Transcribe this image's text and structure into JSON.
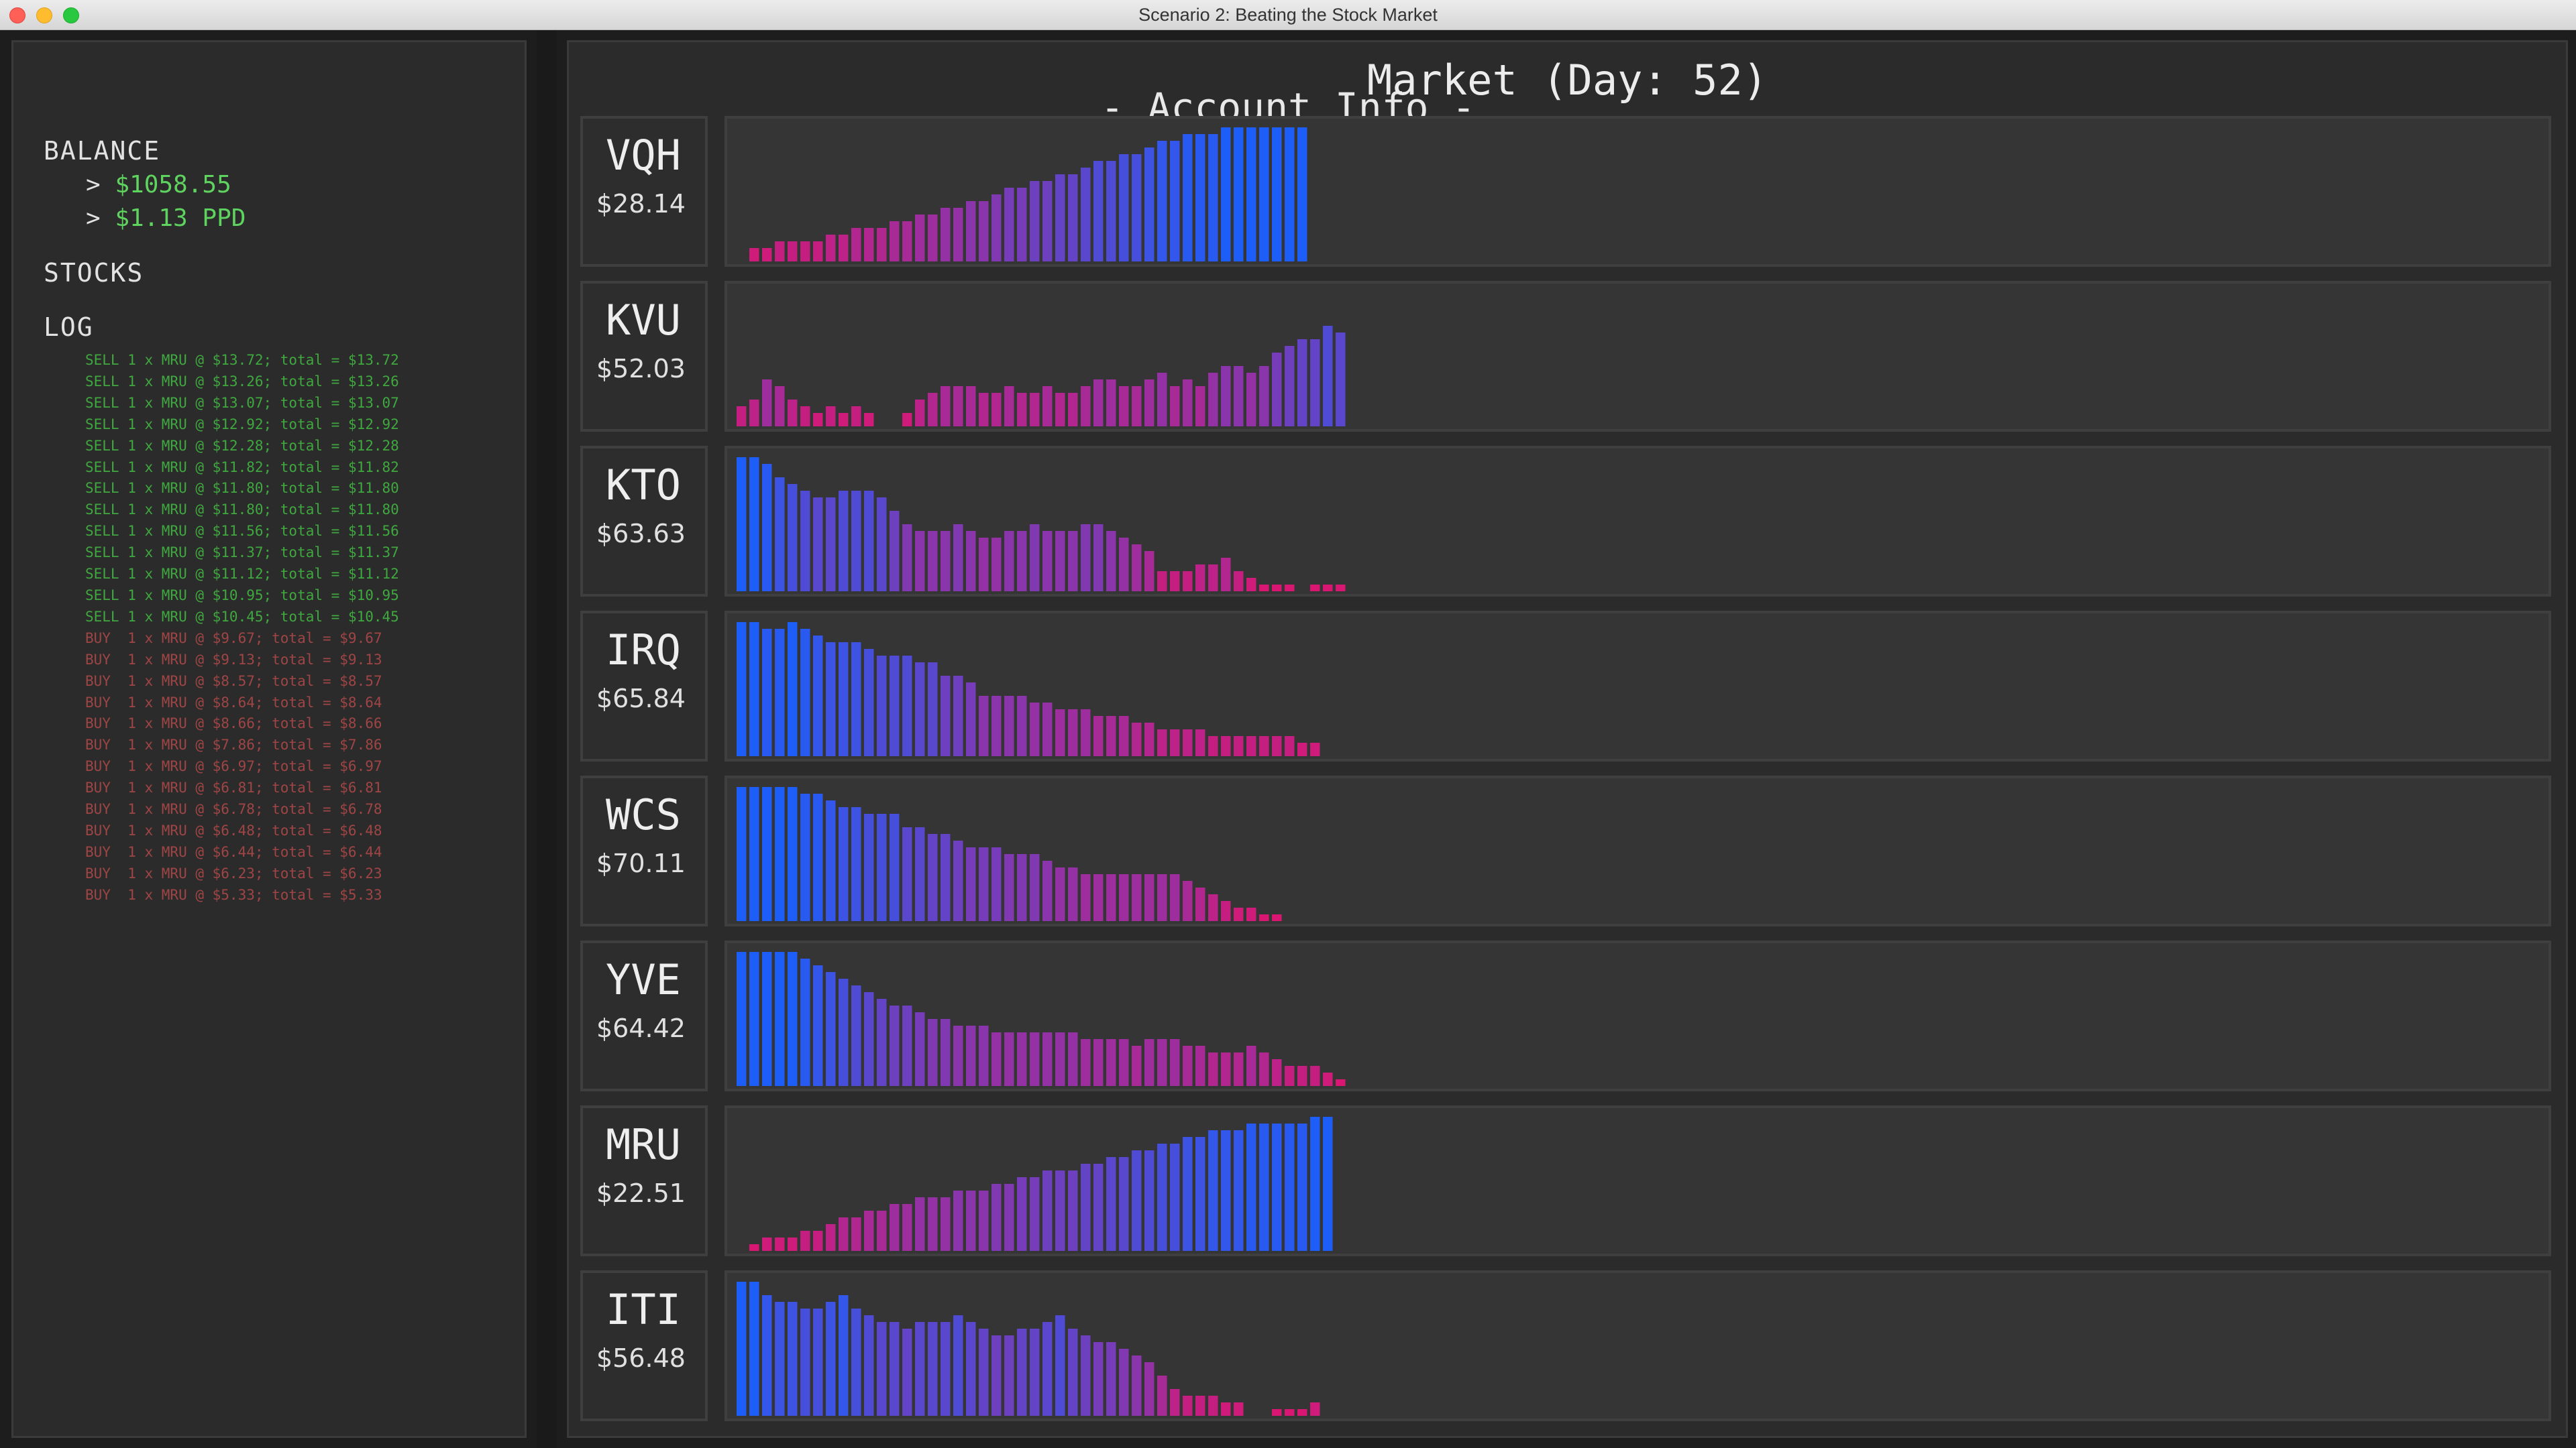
{
  "window": {
    "title": "Scenario 2: Beating the Stock Market"
  },
  "account": {
    "title": "- Account Info -",
    "balance_label": "BALANCE",
    "balance_value": "$1058.55",
    "ppd_value": "$1.13 PPD",
    "stocks_label": "STOCKS",
    "log_label": "LOG",
    "log": [
      {
        "type": "sell",
        "text": "SELL 1 x MRU @ $13.72; total = $13.72"
      },
      {
        "type": "sell",
        "text": "SELL 1 x MRU @ $13.26; total = $13.26"
      },
      {
        "type": "sell",
        "text": "SELL 1 x MRU @ $13.07; total = $13.07"
      },
      {
        "type": "sell",
        "text": "SELL 1 x MRU @ $12.92; total = $12.92"
      },
      {
        "type": "sell",
        "text": "SELL 1 x MRU @ $12.28; total = $12.28"
      },
      {
        "type": "sell",
        "text": "SELL 1 x MRU @ $11.82; total = $11.82"
      },
      {
        "type": "sell",
        "text": "SELL 1 x MRU @ $11.80; total = $11.80"
      },
      {
        "type": "sell",
        "text": "SELL 1 x MRU @ $11.80; total = $11.80"
      },
      {
        "type": "sell",
        "text": "SELL 1 x MRU @ $11.56; total = $11.56"
      },
      {
        "type": "sell",
        "text": "SELL 1 x MRU @ $11.37; total = $11.37"
      },
      {
        "type": "sell",
        "text": "SELL 1 x MRU @ $11.12; total = $11.12"
      },
      {
        "type": "sell",
        "text": "SELL 1 x MRU @ $10.95; total = $10.95"
      },
      {
        "type": "sell",
        "text": "SELL 1 x MRU @ $10.45; total = $10.45"
      },
      {
        "type": "buy",
        "text": "BUY  1 x MRU @ $9.67; total = $9.67"
      },
      {
        "type": "buy",
        "text": "BUY  1 x MRU @ $9.13; total = $9.13"
      },
      {
        "type": "buy",
        "text": "BUY  1 x MRU @ $8.57; total = $8.57"
      },
      {
        "type": "buy",
        "text": "BUY  1 x MRU @ $8.64; total = $8.64"
      },
      {
        "type": "buy",
        "text": "BUY  1 x MRU @ $8.66; total = $8.66"
      },
      {
        "type": "buy",
        "text": "BUY  1 x MRU @ $7.86; total = $7.86"
      },
      {
        "type": "buy",
        "text": "BUY  1 x MRU @ $6.97; total = $6.97"
      },
      {
        "type": "buy",
        "text": "BUY  1 x MRU @ $6.81; total = $6.81"
      },
      {
        "type": "buy",
        "text": "BUY  1 x MRU @ $6.78; total = $6.78"
      },
      {
        "type": "buy",
        "text": "BUY  1 x MRU @ $6.48; total = $6.48"
      },
      {
        "type": "buy",
        "text": "BUY  1 x MRU @ $6.44; total = $6.44"
      },
      {
        "type": "buy",
        "text": "BUY  1 x MRU @ $6.23; total = $6.23"
      },
      {
        "type": "buy",
        "text": "BUY  1 x MRU @ $5.33; total = $5.33"
      }
    ]
  },
  "market": {
    "title": "Market (Day: 52)"
  },
  "colors": {
    "low": "#e3136c",
    "high": "#1e5ef8",
    "panel": "#2b2b2b",
    "chart_bg": "#353535",
    "positive": "#5fd35f",
    "sell": "#3fa83f",
    "buy": "#a04545"
  },
  "chart_data": [
    {
      "type": "bar",
      "ticker": "VQH",
      "price": "$28.14",
      "values": [
        0,
        2,
        2,
        3,
        3,
        3,
        3,
        4,
        4,
        5,
        5,
        5,
        6,
        6,
        7,
        7,
        8,
        8,
        9,
        9,
        10,
        11,
        11,
        12,
        12,
        13,
        13,
        14,
        15,
        15,
        16,
        16,
        17,
        18,
        18,
        19,
        19,
        19,
        20,
        20,
        20,
        20,
        20,
        20,
        20
      ]
    },
    {
      "type": "bar",
      "ticker": "KVU",
      "price": "$52.03",
      "values": [
        3,
        4,
        7,
        6,
        4,
        3,
        2,
        3,
        2,
        3,
        2,
        0,
        0,
        2,
        4,
        5,
        6,
        6,
        6,
        5,
        5,
        6,
        5,
        5,
        6,
        5,
        5,
        6,
        7,
        7,
        6,
        6,
        7,
        8,
        6,
        7,
        6,
        8,
        9,
        9,
        8,
        9,
        11,
        12,
        13,
        13,
        15,
        14
      ]
    },
    {
      "type": "bar",
      "ticker": "KTO",
      "price": "$63.63",
      "values": [
        20,
        20,
        19,
        17,
        16,
        15,
        14,
        14,
        15,
        15,
        15,
        14,
        12,
        10,
        9,
        9,
        9,
        10,
        9,
        8,
        8,
        9,
        9,
        10,
        9,
        9,
        9,
        10,
        10,
        9,
        8,
        7,
        6,
        3,
        3,
        3,
        4,
        4,
        5,
        3,
        2,
        1,
        1,
        1,
        0,
        1,
        1,
        1
      ]
    },
    {
      "type": "bar",
      "ticker": "IRQ",
      "price": "$65.84",
      "values": [
        20,
        20,
        19,
        19,
        20,
        19,
        18,
        17,
        17,
        17,
        16,
        15,
        15,
        15,
        14,
        14,
        12,
        12,
        11,
        9,
        9,
        9,
        9,
        8,
        8,
        7,
        7,
        7,
        6,
        6,
        6,
        5,
        5,
        4,
        4,
        4,
        4,
        3,
        3,
        3,
        3,
        3,
        3,
        3,
        2,
        2
      ]
    },
    {
      "type": "bar",
      "ticker": "WCS",
      "price": "$70.11",
      "values": [
        20,
        20,
        20,
        20,
        20,
        19,
        19,
        18,
        17,
        17,
        16,
        16,
        16,
        14,
        14,
        13,
        13,
        12,
        11,
        11,
        11,
        10,
        10,
        10,
        9,
        8,
        8,
        7,
        7,
        7,
        7,
        7,
        7,
        7,
        7,
        6,
        5,
        4,
        3,
        2,
        2,
        1,
        1,
        0,
        0,
        0,
        0
      ]
    },
    {
      "type": "bar",
      "ticker": "YVE",
      "price": "$64.42",
      "values": [
        20,
        20,
        20,
        20,
        20,
        19,
        18,
        17,
        16,
        15,
        14,
        13,
        12,
        12,
        11,
        10,
        10,
        9,
        9,
        9,
        8,
        8,
        8,
        8,
        8,
        8,
        8,
        7,
        7,
        7,
        7,
        6,
        7,
        7,
        7,
        6,
        6,
        5,
        5,
        5,
        6,
        5,
        4,
        3,
        3,
        3,
        2,
        1
      ]
    },
    {
      "type": "bar",
      "ticker": "MRU",
      "price": "$22.51",
      "values": [
        0,
        1,
        2,
        2,
        2,
        3,
        3,
        4,
        5,
        5,
        6,
        6,
        7,
        7,
        8,
        8,
        8,
        9,
        9,
        9,
        10,
        10,
        11,
        11,
        12,
        12,
        12,
        13,
        13,
        14,
        14,
        15,
        15,
        16,
        16,
        17,
        17,
        18,
        18,
        18,
        19,
        19,
        19,
        19,
        19,
        20,
        20
      ]
    },
    {
      "type": "bar",
      "ticker": "ITI",
      "price": "$56.48",
      "values": [
        20,
        20,
        18,
        17,
        17,
        16,
        16,
        17,
        18,
        16,
        15,
        14,
        14,
        13,
        14,
        14,
        14,
        15,
        14,
        13,
        12,
        12,
        13,
        13,
        14,
        15,
        13,
        12,
        11,
        11,
        10,
        9,
        8,
        6,
        4,
        3,
        3,
        3,
        2,
        2,
        0,
        0,
        1,
        1,
        1,
        2
      ]
    }
  ]
}
